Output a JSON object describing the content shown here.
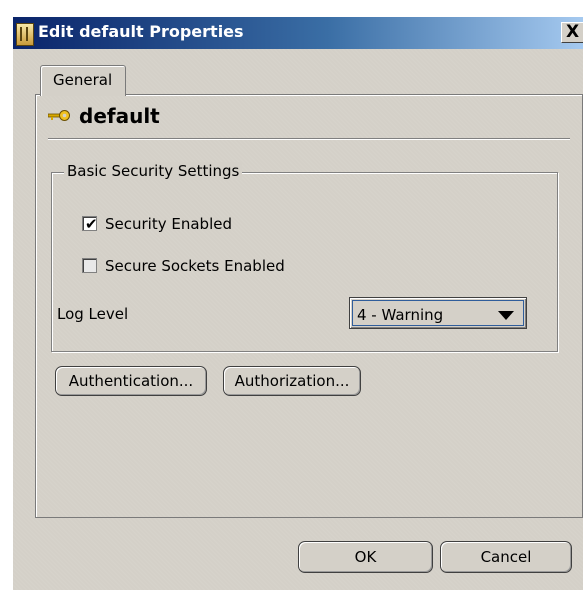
{
  "window": {
    "title": "Edit default Properties",
    "close_label": "X"
  },
  "tabs": [
    {
      "label": "General",
      "selected": true
    }
  ],
  "panel": {
    "heading": "default",
    "group_title": "Basic Security Settings",
    "security_enabled": {
      "label": "Security Enabled",
      "checked": true,
      "mark": "✔"
    },
    "secure_sockets_enabled": {
      "label": "Secure Sockets Enabled",
      "checked": false
    },
    "log_level": {
      "label": "Log Level",
      "value": "4 - Warning"
    },
    "authentication_label": "Authentication...",
    "authorization_label": "Authorization..."
  },
  "footer": {
    "ok_label": "OK",
    "cancel_label": "Cancel"
  },
  "colors": {
    "titlebar_start": "#0a246a",
    "titlebar_end": "#a6caf0",
    "dialog_bg": "#d4d0c8",
    "key_icon": "#e0b000"
  }
}
